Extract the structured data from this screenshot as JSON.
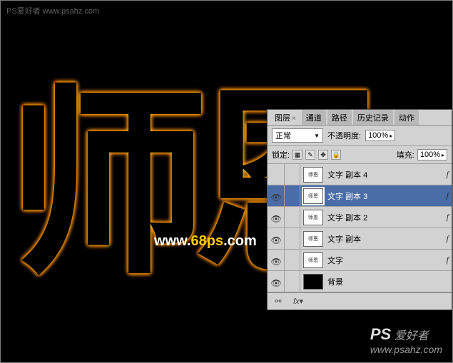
{
  "watermarks": {
    "top": "PS爱好者\nwww.psahz.com",
    "center_www": "www.",
    "center_domain": "68ps",
    "center_com": ".com",
    "bottom_ps": "PS",
    "bottom_text": " 爱好者",
    "bottom_url": "www.psahz.com"
  },
  "calligraphy_text": "师恩",
  "panel": {
    "tabs": [
      "图层",
      "通道",
      "路径",
      "历史记录",
      "动作"
    ],
    "active_tab": 0,
    "blend_mode": "正常",
    "opacity_label": "不透明度:",
    "opacity_value": "100%",
    "lock_label": "锁定:",
    "fill_label": "填充:",
    "fill_value": "100%",
    "layers": [
      {
        "visible": false,
        "name": "文字 副本 4",
        "selected": false,
        "fx": true,
        "thumb": "text"
      },
      {
        "visible": true,
        "name": "文字 副本 3",
        "selected": true,
        "fx": true,
        "thumb": "text"
      },
      {
        "visible": true,
        "name": "文字 副本 2",
        "selected": false,
        "fx": true,
        "thumb": "text"
      },
      {
        "visible": true,
        "name": "文字 副本",
        "selected": false,
        "fx": true,
        "thumb": "text"
      },
      {
        "visible": true,
        "name": "文字",
        "selected": false,
        "fx": true,
        "thumb": "text"
      },
      {
        "visible": true,
        "name": "背景",
        "selected": false,
        "fx": false,
        "thumb": "black"
      }
    ]
  }
}
